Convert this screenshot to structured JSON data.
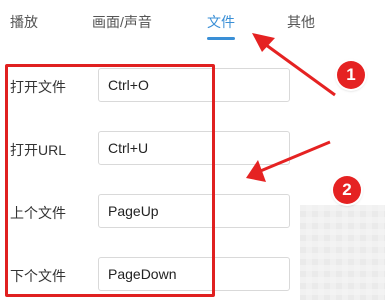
{
  "tabs": [
    {
      "label": "播放"
    },
    {
      "label": "画面/声音"
    },
    {
      "label": "文件",
      "active": true
    },
    {
      "label": "其他"
    }
  ],
  "shortcuts": [
    {
      "label": "打开文件",
      "value": "Ctrl+O"
    },
    {
      "label": "打开URL",
      "value": "Ctrl+U"
    },
    {
      "label": "上个文件",
      "value": "PageUp"
    },
    {
      "label": "下个文件",
      "value": "PageDown"
    }
  ],
  "annotations": {
    "badge1": "1",
    "badge2": "2",
    "color": "#e52222"
  },
  "colors": {
    "accent": "#3a8fd6",
    "highlight": "#e02020"
  }
}
